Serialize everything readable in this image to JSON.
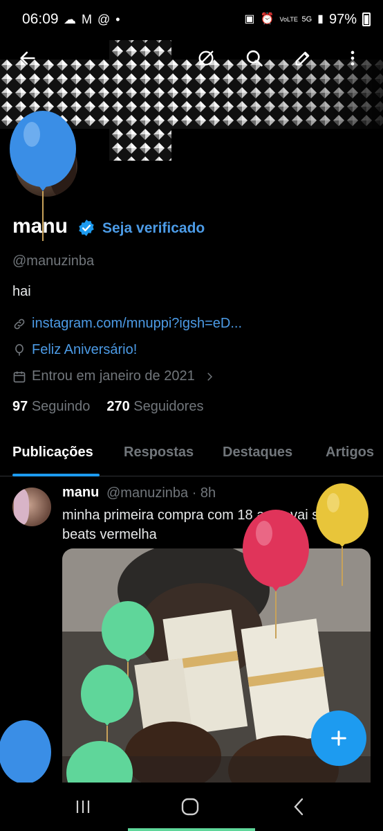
{
  "status_bar": {
    "time": "06:09",
    "battery": "97%",
    "network": "5G",
    "volte": "VoLTE"
  },
  "profile": {
    "name": "manu",
    "verify_cta": "Seja verificado",
    "handle": "@manuzinba",
    "bio": "hai",
    "link": "instagram.com/mnuppi?igsh=eD...",
    "birthday": "Feliz Aniversário!",
    "joined": "Entrou em janeiro de 2021",
    "following_count": "97",
    "following_label": "Seguindo",
    "followers_count": "270",
    "followers_label": "Seguidores"
  },
  "tabs": [
    {
      "label": "Publicações",
      "active": true
    },
    {
      "label": "Respostas",
      "active": false
    },
    {
      "label": "Destaques",
      "active": false
    },
    {
      "label": "Artigos",
      "active": false
    }
  ],
  "post": {
    "author": "manu",
    "handle_time": "@manuzinba · 8h",
    "text": "minha primeira compra com 18 anos vai ser uma beats vermelha"
  },
  "colors": {
    "accent": "#1d9bf0",
    "link": "#4c9be6",
    "muted": "#71767b",
    "balloon_blue": "#3a8ee6",
    "balloon_red": "#e0345a",
    "balloon_yellow": "#e8c53a",
    "balloon_green": "#5fd69a"
  },
  "icons": {
    "back": "arrow-left-icon",
    "grok": "grok-icon",
    "search": "search-icon",
    "edit": "pencil-icon",
    "more": "more-vertical-icon",
    "link": "link-icon",
    "birthday": "balloon-icon",
    "calendar": "calendar-icon",
    "compose": "plus-icon"
  }
}
